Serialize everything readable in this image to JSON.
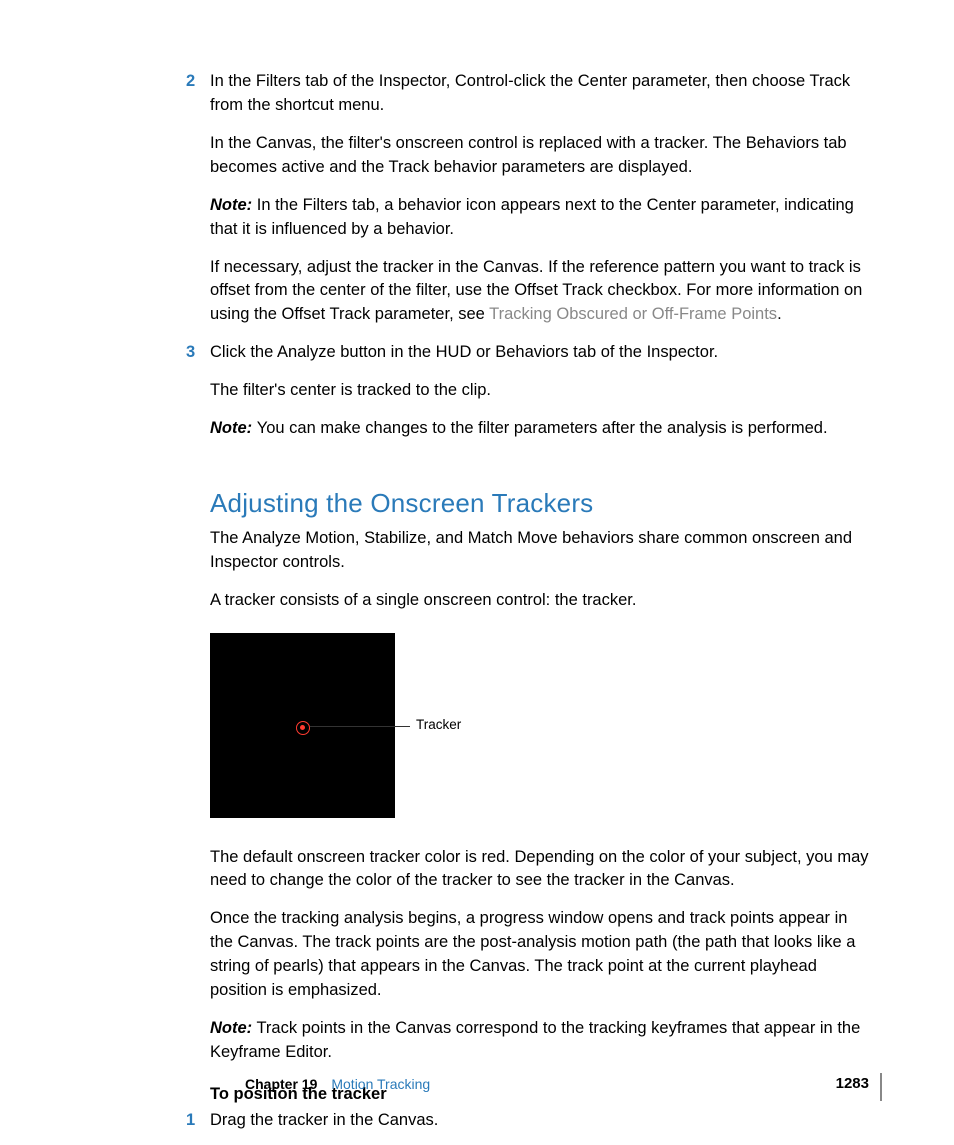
{
  "steps_a": [
    {
      "num": "2",
      "paras": [
        {
          "type": "plain",
          "text": "In the Filters tab of the Inspector, Control-click the Center parameter, then choose Track from the shortcut menu."
        },
        {
          "type": "plain",
          "text": "In the Canvas, the filter's onscreen control is replaced with a tracker. The Behaviors tab becomes active and the Track behavior parameters are displayed."
        },
        {
          "type": "note",
          "label": "Note:",
          "text": "In the Filters tab, a behavior icon appears next to the Center parameter, indicating that it is influenced by a behavior."
        },
        {
          "type": "link",
          "before": "If necessary, adjust the tracker in the Canvas. If the reference pattern you want to track is offset from the center of the filter, use the Offset Track checkbox. For more information on using the Offset Track parameter, see ",
          "link": "Tracking Obscured or Off-Frame Points",
          "after": "."
        }
      ]
    },
    {
      "num": "3",
      "paras": [
        {
          "type": "plain",
          "text": "Click the Analyze button in the HUD or Behaviors tab of the Inspector."
        },
        {
          "type": "plain",
          "text": "The filter's center is tracked to the clip."
        },
        {
          "type": "note",
          "label": "Note:",
          "text": "You can make changes to the filter parameters after the analysis is performed."
        }
      ]
    }
  ],
  "section": {
    "heading": "Adjusting the Onscreen Trackers",
    "intro1": "The Analyze Motion, Stabilize, and Match Move behaviors share common onscreen and Inspector controls.",
    "intro2": "A tracker consists of a single onscreen control: the tracker.",
    "figure_label": "Tracker",
    "after1": "The default onscreen tracker color is red. Depending on the color of your subject, you may need to change the color of the tracker to see the tracker in the Canvas.",
    "after2": "Once the tracking analysis begins, a progress window opens and track points appear in the Canvas. The track points are the post-analysis motion path (the path that looks like a string of pearls) that appears in the Canvas. The track point at the current playhead position is emphasized.",
    "note_label": "Note:",
    "note_text": "Track points in the Canvas correspond to the tracking keyframes that appear in the Keyframe Editor.",
    "task_title": "To position the tracker",
    "task_step_num": "1",
    "task_step_text": "Drag the tracker in the Canvas."
  },
  "footer": {
    "chapter": "Chapter 19",
    "title": "Motion Tracking",
    "page": "1283"
  }
}
